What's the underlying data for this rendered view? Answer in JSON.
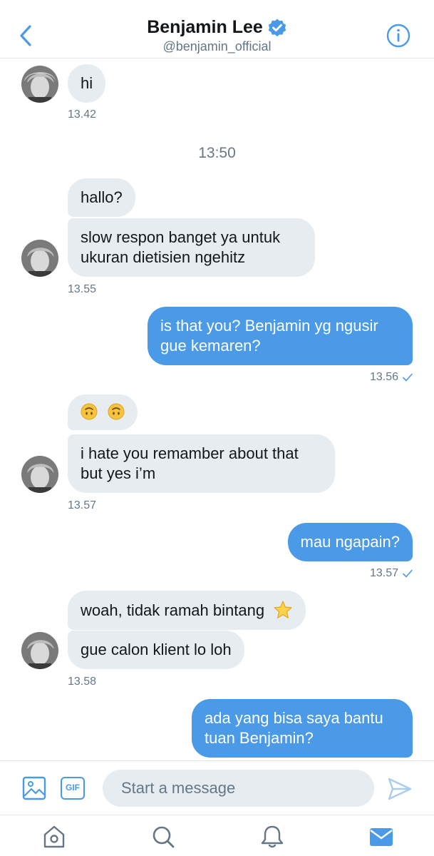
{
  "header": {
    "name": "Benjamin Lee",
    "handle": "@benjamin_official",
    "verified": true
  },
  "messages": [
    {
      "from": "them",
      "text": "hi"
    },
    {
      "time": "13.42"
    },
    {
      "divider": "13:50"
    },
    {
      "from": "them",
      "text": "hallo?"
    },
    {
      "from": "them",
      "lines": [
        "slow respon banget ya untuk",
        "ukuran dietisien ngehitz"
      ]
    },
    {
      "time": "13.55"
    },
    {
      "from": "me",
      "lines": [
        "is that you? Benjamin yg ngusir",
        "gue kemaren?"
      ]
    },
    {
      "time": "13.56"
    },
    {
      "from": "them",
      "emoji": [
        "upside-down-face",
        "upside-down-face"
      ]
    },
    {
      "from": "them",
      "lines": [
        "i hate you remamber about that",
        "but yes i’m"
      ]
    },
    {
      "time": "13.57"
    },
    {
      "from": "me",
      "text": "mau ngapain?"
    },
    {
      "time": "13.57"
    },
    {
      "from": "them",
      "text": "woah, tidak ramah bintang",
      "emoji": [
        "star"
      ]
    },
    {
      "from": "them",
      "text": "gue calon klient lo loh"
    },
    {
      "time": "13.58"
    },
    {
      "from": "me",
      "lines": [
        "ada yang bisa saya bantu",
        "tuan Benjamin?"
      ]
    }
  ],
  "m": {
    "m1": "hi",
    "t1": "13.42",
    "d1": "13:50",
    "m2": "hallo?",
    "m3a": "slow respon banget ya untuk",
    "m3b": "ukuran dietisien ngehitz",
    "t2": "13.55",
    "m4a": "is that you? Benjamin yg ngusir",
    "m4b": "gue kemaren?",
    "t3": "13.56",
    "m6a": "i hate you remamber about that",
    "m6b": "but yes i’m",
    "t4": "13.57",
    "m7": "mau ngapain?",
    "t5": "13.57",
    "m8": "woah, tidak ramah bintang",
    "m9": "gue calon klient lo loh",
    "t6": "13.58",
    "m10a": "ada yang bisa saya bantu",
    "m10b": "tuan Benjamin?"
  },
  "composer": {
    "placeholder": "Start a message",
    "gif_label": "GIF",
    "icons": [
      "image-icon",
      "gif-icon",
      "send-icon"
    ]
  },
  "tabbar": {
    "items": [
      "home-icon",
      "search-icon",
      "notifications-icon",
      "messages-icon"
    ],
    "active": "messages-icon"
  },
  "colors": {
    "accent": "#4a9ae8",
    "received_bubble": "#e6ecf0",
    "muted_text": "#657786",
    "text": "#14171a"
  }
}
